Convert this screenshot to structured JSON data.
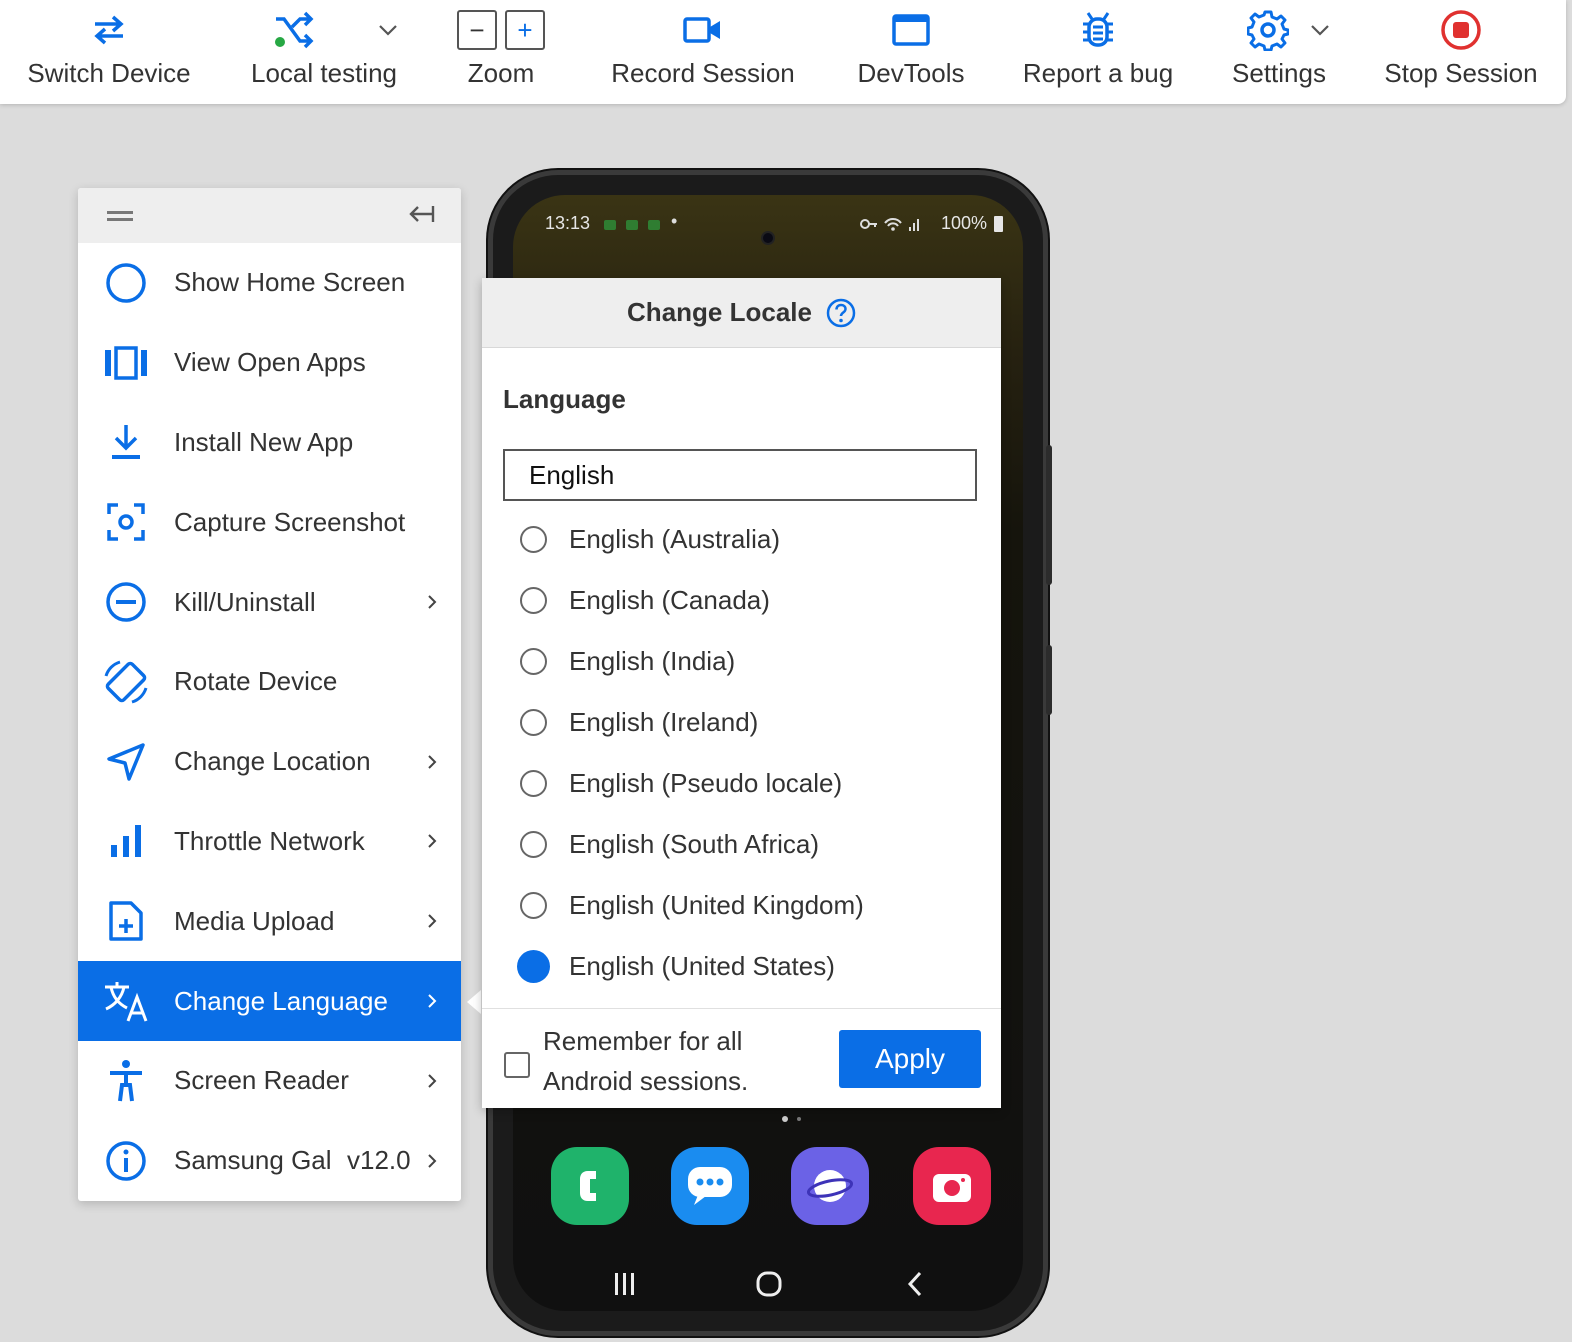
{
  "toolbar": {
    "switch_device": "Switch Device",
    "local_testing": "Local testing",
    "zoom": "Zoom",
    "zoom_out": "−",
    "zoom_in": "+",
    "record_session": "Record Session",
    "devtools": "DevTools",
    "report_bug": "Report a bug",
    "settings": "Settings",
    "stop_session": "Stop Session"
  },
  "sidebar": {
    "items": [
      {
        "label": "Show Home Screen",
        "icon": "circle-icon"
      },
      {
        "label": "View Open Apps",
        "icon": "open-apps-icon"
      },
      {
        "label": "Install New App",
        "icon": "download-icon"
      },
      {
        "label": "Capture Screenshot",
        "icon": "screenshot-icon"
      },
      {
        "label": "Kill/Uninstall",
        "icon": "minus-circle-icon"
      },
      {
        "label": "Rotate Device",
        "icon": "rotate-icon"
      },
      {
        "label": "Change Location",
        "icon": "location-arrow-icon"
      },
      {
        "label": "Throttle Network",
        "icon": "signal-bars-icon"
      },
      {
        "label": "Media Upload",
        "icon": "file-plus-icon"
      },
      {
        "label": "Change Language",
        "icon": "translate-icon"
      },
      {
        "label": "Screen Reader",
        "icon": "accessibility-icon"
      },
      {
        "label": "Samsung Gal",
        "icon": "info-icon"
      }
    ],
    "device_version": "v12.0"
  },
  "phone": {
    "time": "13:13",
    "battery": "100%"
  },
  "locale_dialog": {
    "title": "Change Locale",
    "language_label": "Language",
    "search_value": "English",
    "options": [
      "English (Australia)",
      "English (Canada)",
      "English (India)",
      "English (Ireland)",
      "English (Pseudo locale)",
      "English (South Africa)",
      "English (United Kingdom)",
      "English (United States)"
    ],
    "selected": "English (United States)",
    "remember_text": "Remember for all Android sessions.",
    "apply_label": "Apply"
  },
  "colors": {
    "accent": "#0a6ee6",
    "stop_red": "#e0312f",
    "local_green": "#27a844"
  }
}
